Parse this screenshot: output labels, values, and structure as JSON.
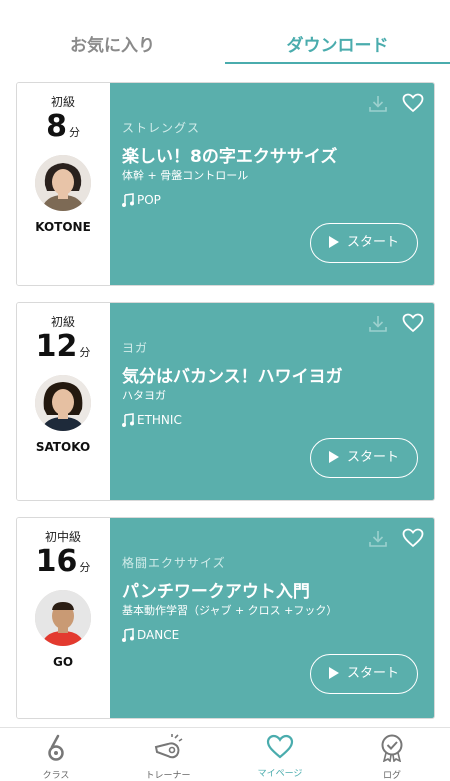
{
  "tabs": {
    "favorites": "お気に入り",
    "downloads": "ダウンロード"
  },
  "cards": [
    {
      "level": "初級",
      "duration": "8",
      "unit": "分",
      "trainer": "KOTONE",
      "category": "ストレングス",
      "title": "楽しい！8の字エクササイズ",
      "subtitle": "体幹 + 骨盤コントロール",
      "music": "POP",
      "start_label": "スタート"
    },
    {
      "level": "初級",
      "duration": "12",
      "unit": "分",
      "trainer": "SATOKO",
      "category": "ヨガ",
      "title": "気分はバカンス！ハワイヨガ",
      "subtitle": "ハタヨガ",
      "music": "ETHNIC",
      "start_label": "スタート"
    },
    {
      "level": "初中級",
      "duration": "16",
      "unit": "分",
      "trainer": "GO",
      "category": "格闘エクササイズ",
      "title": "パンチワークアウト入門",
      "subtitle": "基本動作学習（ジャブ + クロス +フック）",
      "music": "DANCE",
      "start_label": "スタート"
    }
  ],
  "nav": {
    "class": "クラス",
    "trainer": "トレーナー",
    "mypage": "マイページ",
    "log": "ログ"
  },
  "colors": {
    "accent": "#4aacad",
    "card": "#5aafac"
  }
}
